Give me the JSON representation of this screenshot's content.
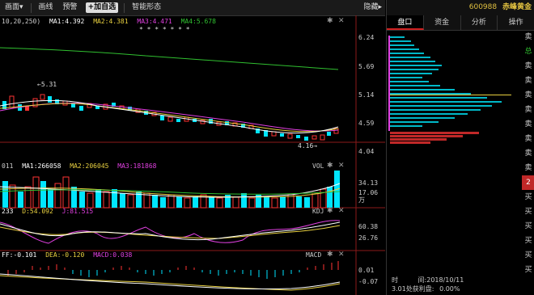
{
  "toolbar": {
    "items": [
      "画面▾",
      "画线",
      "预警"
    ],
    "add_btn": "+加自选",
    "smart": "智能形态",
    "hide": "隐藏▸"
  },
  "main_chart": {
    "ma_params": "10,20,250)",
    "ma1": "MA1:4.392",
    "ma2": "MA2:4.381",
    "ma3": "MA3:4.471",
    "ma4": "MA4:5.678",
    "stars": "* *       *      * *       *    *",
    "high_label": "←5.31",
    "low_label": "4.16→",
    "price_axis": [
      "6.24",
      "5.69",
      "5.14",
      "4.59",
      "4.04"
    ]
  },
  "vol_chart": {
    "vol_value": "011",
    "ma1": "MA1:266058",
    "ma2": "MA2:206045",
    "ma3": "MA3:181868",
    "title": "VOL",
    "axis": [
      "34.13",
      "17.06",
      "万"
    ]
  },
  "kdj_chart": {
    "k": "233",
    "d": "D:54.092",
    "j": "J:81.515",
    "title": "KDJ",
    "axis": [
      "60.38",
      "26.76"
    ]
  },
  "macd_chart": {
    "dif": "FF:-0.101",
    "dea": "DEA:-0.120",
    "macd": "MACD:0.038",
    "title": "MACD",
    "axis": [
      "0.01",
      "-0.07"
    ]
  },
  "right_panel": {
    "code": "600988",
    "name": "赤峰黄金",
    "tabs": [
      "盘口",
      "资金",
      "分析",
      "操作"
    ],
    "side_labels": [
      "卖",
      "总",
      "卖",
      "卖",
      "卖",
      "卖",
      "卖",
      "卖",
      "卖",
      "卖",
      "卖",
      "卖",
      "买",
      "买",
      "买",
      "买",
      "买",
      "买"
    ],
    "highlight_label": "2",
    "time_label": "时",
    "date_label": "间:2018/10/11",
    "profit_label": "3.01处获利盘:",
    "profit_value": "0.00%"
  },
  "colors": {
    "up": "#ff3333",
    "down": "#00e5ff",
    "ma_white": "#ffffff",
    "ma_yellow": "#e8d040",
    "ma_magenta": "#e040e0",
    "ma_green": "#30c030"
  }
}
